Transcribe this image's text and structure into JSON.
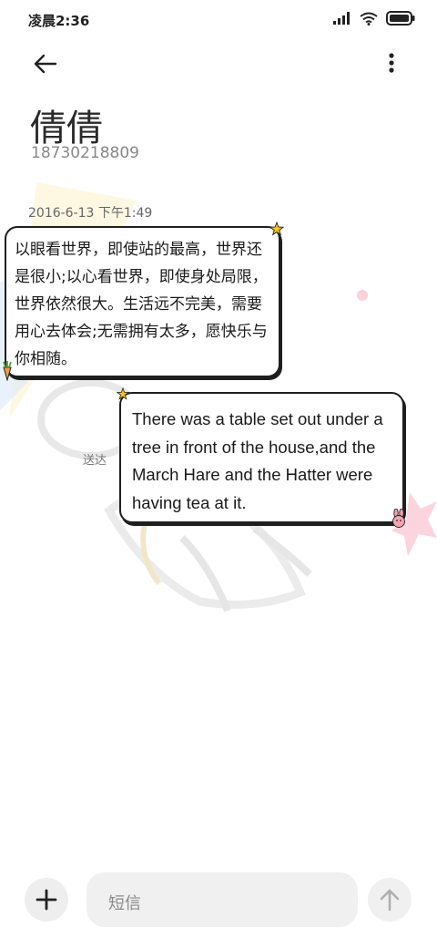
{
  "status_bar": {
    "time": "凌晨2:36",
    "icons": [
      "signal-icon",
      "wifi-icon",
      "battery-icon"
    ]
  },
  "top_bar": {
    "back_icon": "arrow-left-icon",
    "more_icon": "more-vertical-icon"
  },
  "contact": {
    "name": "倩倩",
    "number": "18730218809"
  },
  "conversation": {
    "timestamp": "2016-6-13 下午1:49",
    "messages": [
      {
        "direction": "incoming",
        "text": "以眼看世界，即使站的最高，世界还是很小;以心看世界，即使身处局限，世界依然很大。生活远不完美，需要用心去体会;无需拥有太多，愿快乐与你相随。"
      },
      {
        "direction": "outgoing",
        "text": "There was a table set out under a tree in front of the house,and the March Hare and the Hatter were having tea at it.",
        "status": "送达"
      }
    ]
  },
  "composer": {
    "add_icon": "plus-icon",
    "placeholder": "短信",
    "send_icon": "arrow-up-icon"
  },
  "colors": {
    "bubble_border": "#1f1f1f",
    "accent_star": "#f5c518",
    "accent_pink": "#f6a3b5"
  }
}
